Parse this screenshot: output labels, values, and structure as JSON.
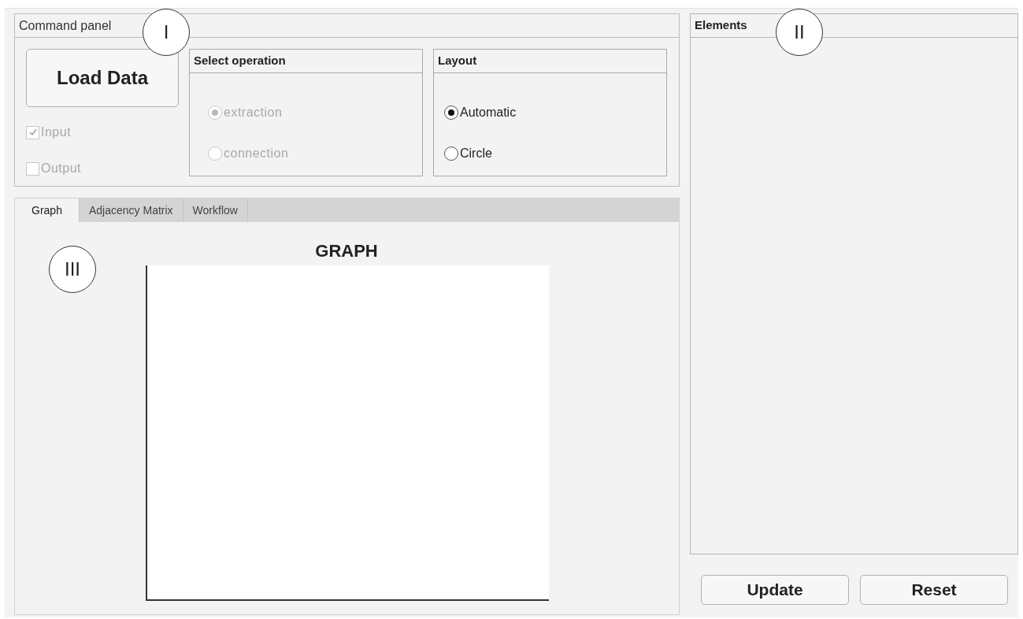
{
  "command_panel": {
    "title": "Command panel",
    "load_button": "Load Data",
    "checkboxes": [
      {
        "label": "Input",
        "checked": true,
        "disabled": true
      },
      {
        "label": "Output",
        "checked": false,
        "disabled": true
      }
    ],
    "groups": [
      {
        "title": "Select operation",
        "disabled": true,
        "options": [
          {
            "label": "extraction",
            "selected": true
          },
          {
            "label": "connection",
            "selected": false
          }
        ]
      },
      {
        "title": "Layout",
        "disabled": false,
        "options": [
          {
            "label": "Automatic",
            "selected": true
          },
          {
            "label": "Circle",
            "selected": false
          }
        ]
      }
    ]
  },
  "tabs": [
    {
      "label": "Graph",
      "selected": true
    },
    {
      "label": "Adjacency Matrix",
      "selected": false
    },
    {
      "label": "Workflow",
      "selected": false
    }
  ],
  "graph": {
    "title": "GRAPH"
  },
  "elements_panel": {
    "title": "Elements"
  },
  "buttons": [
    "Update",
    "Reset"
  ],
  "callouts": [
    {
      "label": "I"
    },
    {
      "label": "II"
    },
    {
      "label": "III"
    }
  ]
}
